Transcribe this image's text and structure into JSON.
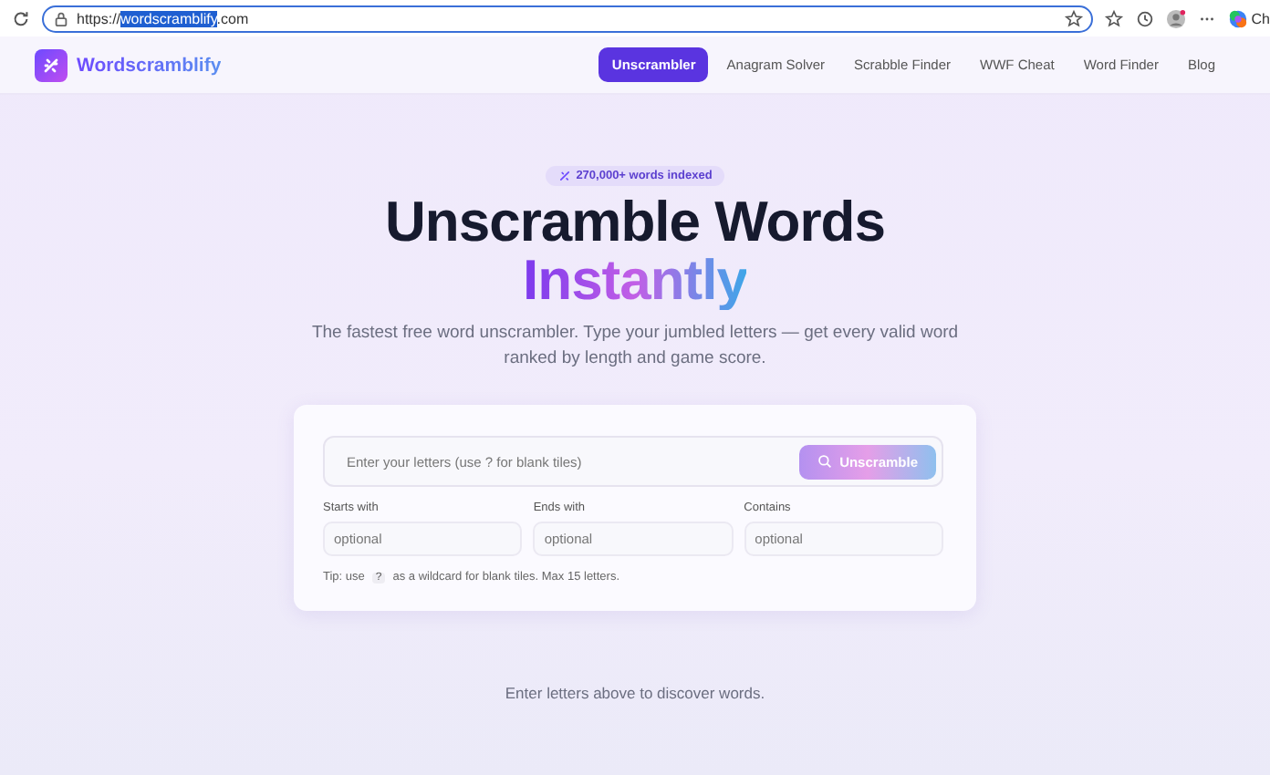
{
  "browser": {
    "url_scheme": "https://",
    "url_host_selected": "wordscramblify",
    "url_rest": ".com",
    "profile_cut": "Ch"
  },
  "site": {
    "brand": "Wordscramblify",
    "nav": [
      {
        "label": "Unscrambler",
        "selected": true
      },
      {
        "label": "Anagram Solver",
        "selected": false
      },
      {
        "label": "Scrabble Finder",
        "selected": false
      },
      {
        "label": "WWF Cheat",
        "selected": false
      },
      {
        "label": "Word Finder",
        "selected": false
      },
      {
        "label": "Blog",
        "selected": false
      }
    ]
  },
  "hero": {
    "badge": "270,000+ words indexed",
    "title": "Unscramble Words",
    "title_accent": "Instantly",
    "subtitle": "The fastest free word unscrambler. Type your jumbled letters — get every valid word ranked by length and game score."
  },
  "search": {
    "placeholder": "Enter your letters (use ? for blank tiles)",
    "button": "Unscramble",
    "filters": [
      {
        "label": "Starts with",
        "placeholder": "optional"
      },
      {
        "label": "Ends with",
        "placeholder": "optional"
      },
      {
        "label": "Contains",
        "placeholder": "optional"
      }
    ],
    "tip": {
      "before": "Tip: use",
      "key": "?",
      "after": "as a wildcard for blank tiles. Max 15 letters."
    }
  },
  "empty_state": "Enter letters above to discover words."
}
